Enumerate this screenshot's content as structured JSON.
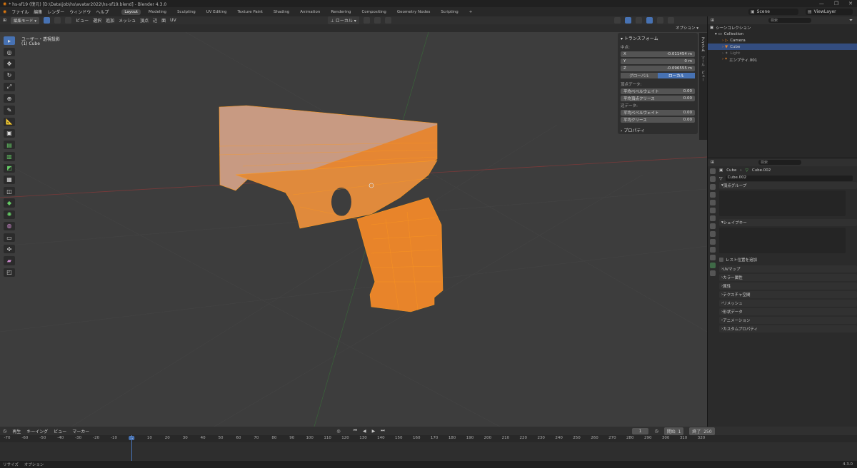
{
  "titlebar": {
    "title": "* hs-sf19 (復元) [D:\\Data\\job\\hs\\avatar2022\\hs-sf19.blend] - Blender 4.3.0",
    "controls": [
      "—",
      "❐",
      "✕"
    ]
  },
  "topbar": {
    "menus": [
      "ファイル",
      "編集",
      "レンダー",
      "ウィンドウ",
      "ヘルプ"
    ],
    "workspaces": [
      "Layout",
      "Modeling",
      "Sculpting",
      "UV Editing",
      "Texture Paint",
      "Shading",
      "Animation",
      "Rendering",
      "Compositing",
      "Geometry Nodes",
      "Scripting"
    ],
    "active_workspace": "Layout",
    "scene": "Scene",
    "view_layer": "ViewLayer"
  },
  "viewport_header": {
    "mode": "編集モード",
    "menus": [
      "ビュー",
      "選択",
      "追加",
      "メッシュ",
      "頂点",
      "辺",
      "面",
      "UV"
    ],
    "transform_orientation": "ローカル",
    "options": "オプション"
  },
  "viewport": {
    "view_name": "ユーザー・透視投影",
    "object_label": "(1) Cube"
  },
  "npanel": {
    "header": "トランスフォーム",
    "median_label": "中点:",
    "fields": [
      {
        "axis": "X",
        "value": "-0.011454 m"
      },
      {
        "axis": "Y",
        "value": "0 m"
      },
      {
        "axis": "Z",
        "value": "-0.096555 m"
      }
    ],
    "space_global": "グローバル",
    "space_local": "ローカル",
    "vertex_data_label": "頂点データ:",
    "vertex_fields": [
      {
        "label": "平均ベベルウェイト",
        "value": "0.00"
      },
      {
        "label": "平均頂点クリース",
        "value": "0.00"
      }
    ],
    "edge_data_label": "辺データ:",
    "edge_fields": [
      {
        "label": "平均ベベルウェイト",
        "value": "0.00"
      },
      {
        "label": "平均クリース",
        "value": "0.00"
      }
    ],
    "properties_section": "プロパティ",
    "tabs": [
      "アイテム",
      "ツール",
      "ビュー"
    ]
  },
  "outliner": {
    "search_placeholder": "検索",
    "root": "シーンコレクション",
    "items": [
      {
        "name": "Collection",
        "depth": 1
      },
      {
        "name": "Camera",
        "depth": 2
      },
      {
        "name": "Cube",
        "depth": 2
      },
      {
        "name": "Light",
        "depth": 2
      },
      {
        "name": "エンプティ.001",
        "depth": 2
      }
    ],
    "selected": "Cube"
  },
  "properties": {
    "search_placeholder": "検索",
    "breadcrumb_object": "Cube",
    "breadcrumb_mesh": "Cube.002",
    "mesh_name": "Cube.002",
    "vertex_groups": "頂点グループ",
    "shape_keys": "シェイプキー",
    "rest_position": "レスト位置を追加",
    "sections": [
      "UVマップ",
      "カラー属性",
      "属性",
      "テクスチャ空間",
      "リメッシュ",
      "形状データ",
      "アニメーション",
      "カスタムプロパティ"
    ]
  },
  "timeline": {
    "menus": [
      "再生",
      "キーイング",
      "ビュー",
      "マーカー"
    ],
    "current_frame": "1",
    "start_label": "開始",
    "start_value": "1",
    "end_label": "終了",
    "end_value": "250",
    "ticks": [
      "-70",
      "-60",
      "-50",
      "-40",
      "-30",
      "-20",
      "-10",
      "1",
      "10",
      "20",
      "30",
      "40",
      "50",
      "60",
      "70",
      "80",
      "90",
      "100",
      "110",
      "120",
      "130",
      "140",
      "150",
      "160",
      "170",
      "180",
      "190",
      "200",
      "210",
      "220",
      "230",
      "240",
      "250",
      "260",
      "270",
      "280",
      "290",
      "300",
      "310",
      "320"
    ]
  },
  "statusbar": {
    "left1": "リサイズ",
    "left2": "オプション",
    "version": "4.3.0"
  },
  "colors": {
    "accent": "#4772b3",
    "wire": "#ff9a1f",
    "mesh_selected": "#e8842a",
    "background": "#3d3d3d"
  }
}
